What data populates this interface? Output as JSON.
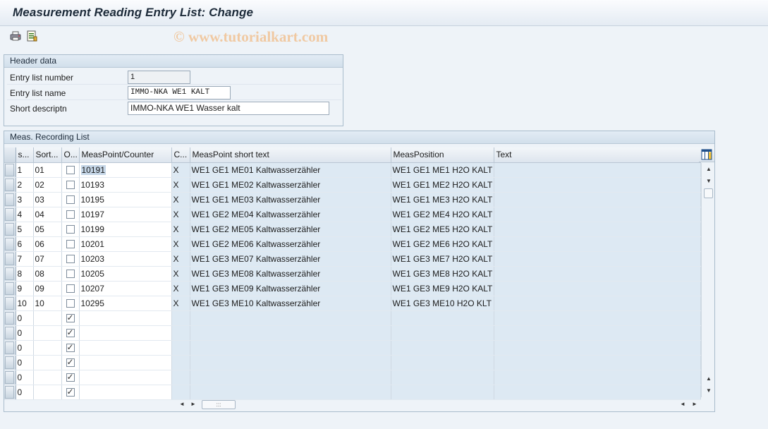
{
  "window": {
    "title": "Measurement Reading Entry List: Change"
  },
  "toolbar": {
    "icons": [
      "print-icon",
      "list-icon"
    ],
    "watermark": "© www.tutorialkart.com"
  },
  "header": {
    "title": "Header data",
    "fields": [
      {
        "label": "Entry list number",
        "value": "1"
      },
      {
        "label": "Entry list name",
        "value": "IMMO-NKA WE1 KALT"
      },
      {
        "label": "Short descriptn",
        "value": "IMMO-NKA WE1 Wasser kalt"
      }
    ]
  },
  "list": {
    "title": "Meas. Recording List",
    "columns": [
      "s...",
      "Sort...",
      "O...",
      "MeasPoint/Counter",
      "C...",
      "MeasPoint short text",
      "MeasPosition",
      "Text"
    ],
    "rows": [
      {
        "s": "1",
        "sort": "01",
        "o": false,
        "point": "10191",
        "c": "X",
        "short": "WE1 GE1 ME01 Kaltwasserzähler",
        "pos": "WE1 GE1 ME1 H2O KALT",
        "text": ""
      },
      {
        "s": "2",
        "sort": "02",
        "o": false,
        "point": "10193",
        "c": "X",
        "short": "WE1 GE1 ME02 Kaltwasserzähler",
        "pos": "WE1 GE1 ME2 H2O KALT",
        "text": ""
      },
      {
        "s": "3",
        "sort": "03",
        "o": false,
        "point": "10195",
        "c": "X",
        "short": "WE1 GE1 ME03 Kaltwasserzähler",
        "pos": "WE1 GE1 ME3 H2O KALT",
        "text": ""
      },
      {
        "s": "4",
        "sort": "04",
        "o": false,
        "point": "10197",
        "c": "X",
        "short": "WE1 GE2 ME04 Kaltwasserzähler",
        "pos": "WE1 GE2 ME4 H2O KALT",
        "text": ""
      },
      {
        "s": "5",
        "sort": "05",
        "o": false,
        "point": "10199",
        "c": "X",
        "short": "WE1 GE2 ME05 Kaltwasserzähler",
        "pos": "WE1 GE2 ME5 H2O KALT",
        "text": ""
      },
      {
        "s": "6",
        "sort": "06",
        "o": false,
        "point": "10201",
        "c": "X",
        "short": "WE1 GE2 ME06 Kaltwasserzähler",
        "pos": "WE1 GE2 ME6 H2O KALT",
        "text": ""
      },
      {
        "s": "7",
        "sort": "07",
        "o": false,
        "point": "10203",
        "c": "X",
        "short": "WE1 GE3 ME07 Kaltwasserzähler",
        "pos": "WE1 GE3 ME7 H2O KALT",
        "text": ""
      },
      {
        "s": "8",
        "sort": "08",
        "o": false,
        "point": "10205",
        "c": "X",
        "short": "WE1 GE3 ME08 Kaltwasserzähler",
        "pos": "WE1 GE3 ME8 H2O KALT",
        "text": ""
      },
      {
        "s": "9",
        "sort": "09",
        "o": false,
        "point": "10207",
        "c": "X",
        "short": "WE1 GE3 ME09 Kaltwasserzähler",
        "pos": "WE1 GE3 ME9 H2O KALT",
        "text": ""
      },
      {
        "s": "10",
        "sort": "10",
        "o": false,
        "point": "10295",
        "c": "X",
        "short": "WE1 GE3 ME10 Kaltwasserzähler",
        "pos": "WE1 GE3 ME10 H2O KLT",
        "text": ""
      },
      {
        "s": "0",
        "sort": "",
        "o": true,
        "point": "",
        "c": "",
        "short": "",
        "pos": "",
        "text": ""
      },
      {
        "s": "0",
        "sort": "",
        "o": true,
        "point": "",
        "c": "",
        "short": "",
        "pos": "",
        "text": ""
      },
      {
        "s": "0",
        "sort": "",
        "o": true,
        "point": "",
        "c": "",
        "short": "",
        "pos": "",
        "text": ""
      },
      {
        "s": "0",
        "sort": "",
        "o": true,
        "point": "",
        "c": "",
        "short": "",
        "pos": "",
        "text": ""
      },
      {
        "s": "0",
        "sort": "",
        "o": true,
        "point": "",
        "c": "",
        "short": "",
        "pos": "",
        "text": ""
      },
      {
        "s": "0",
        "sort": "",
        "o": true,
        "point": "",
        "c": "",
        "short": "",
        "pos": "",
        "text": ""
      }
    ]
  },
  "scroll": {
    "up": "▲",
    "down": "▼",
    "left": "◄",
    "right": "►",
    "grip": ":::"
  }
}
